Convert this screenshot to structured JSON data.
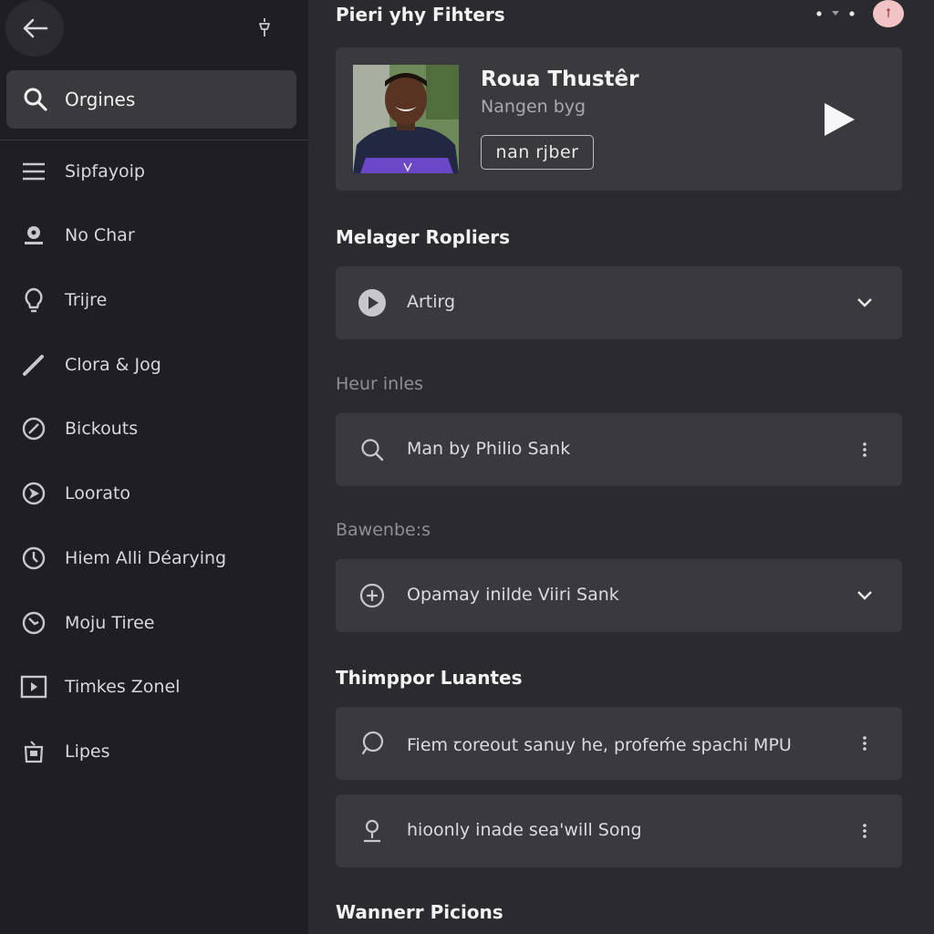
{
  "sidebar": {
    "search_label": "Orgines",
    "items": [
      {
        "label": "Sipfayoip",
        "icon": "menu-icon"
      },
      {
        "label": "No Char",
        "icon": "user-badge-icon"
      },
      {
        "label": "Trijre",
        "icon": "bulb-icon"
      },
      {
        "label": "Clora & Jog",
        "icon": "pen-icon"
      },
      {
        "label": "Bickouts",
        "icon": "block-icon"
      },
      {
        "label": "Loorato",
        "icon": "compass-icon"
      },
      {
        "label": "Hiem Alli Déarying",
        "icon": "clock-icon"
      },
      {
        "label": "Moju Tiree",
        "icon": "history-icon"
      },
      {
        "label": "Timkes Zonel",
        "icon": "video-icon"
      },
      {
        "label": "Lipes",
        "icon": "shop-icon"
      }
    ]
  },
  "header": {
    "title": "Pieri yhy Fihters",
    "avatar_text": "ꝉ"
  },
  "hero": {
    "name": "Roua Thustêr",
    "subtitle": "Nangen byg",
    "button_label": "nan rjber"
  },
  "sections": [
    {
      "title": "Melager Ropliers"
    },
    {
      "subtitle": "Heur inles"
    },
    {
      "subtitle": "Bawenbe:s"
    },
    {
      "title": "Thimppor Luantes"
    },
    {
      "title": "Wannerr Picions"
    }
  ],
  "rows": [
    {
      "label": "Artirg",
      "icon": "play-circle-icon",
      "trail": "chevron-down-icon"
    },
    {
      "label": "Man by Philio Sank",
      "icon": "search-icon",
      "trail": "more-vertical-icon"
    },
    {
      "label": "Opamay inilde Viiri Sank",
      "icon": "add-circle-icon",
      "trail": "chevron-down-icon"
    },
    {
      "label": "Fiem ꞇoreout sanuy he, profeḿe spachi MPU",
      "icon": "chat-icon",
      "trail": "more-vertical-icon"
    },
    {
      "label": "hioonly inade sea'will Song",
      "icon": "pin-icon",
      "trail": "more-vertical-icon"
    }
  ],
  "colors": {
    "sidebar_bg": "#1f1f23",
    "main_bg": "#2b2b2f",
    "card_bg": "#3a3a3e",
    "accent_purple": "#5b3fb8"
  }
}
